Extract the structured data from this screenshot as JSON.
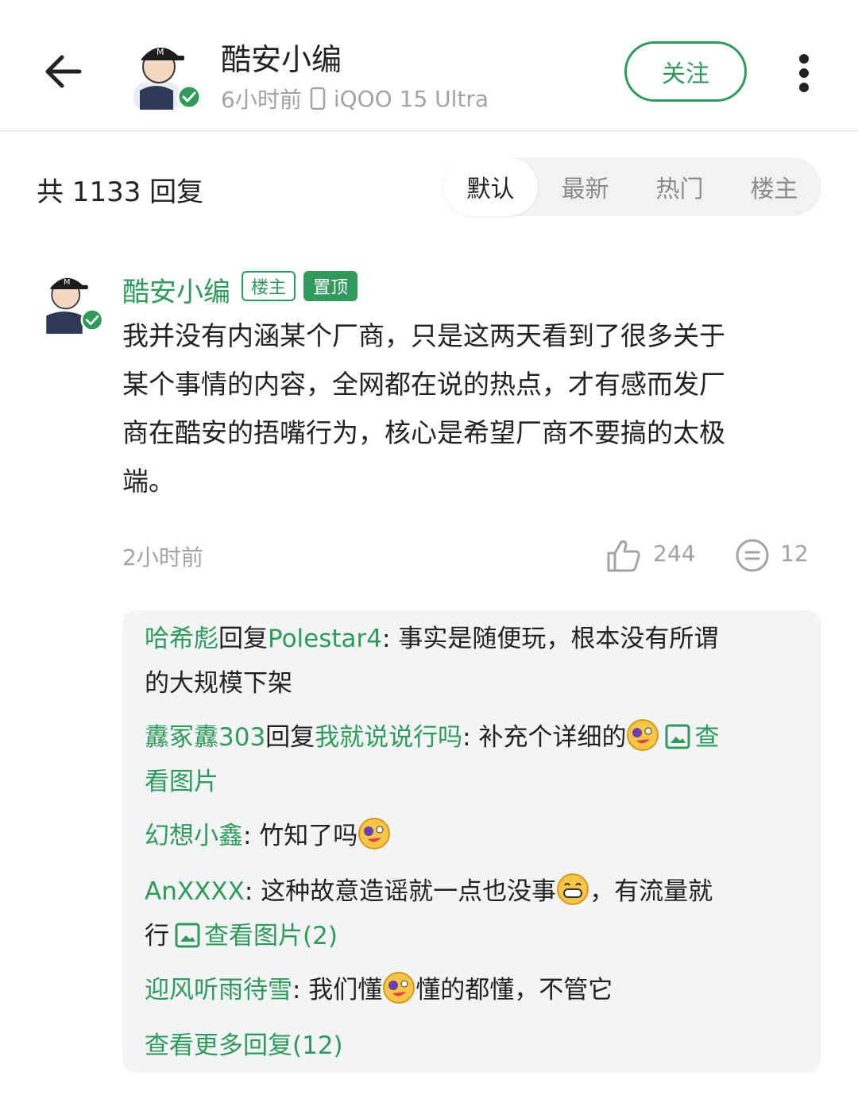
{
  "header": {
    "title": "酷安小编",
    "time": "6小时前",
    "device": "iQOO 15 Ultra",
    "follow_label": "关注"
  },
  "reply_bar": {
    "count_text": "共 1133 回复",
    "tabs": [
      "默认",
      "最新",
      "热门",
      "楼主"
    ],
    "active_tab": "默认"
  },
  "comment": {
    "author": "酷安小编",
    "badge_owner": "楼主",
    "badge_pinned": "置顶",
    "lines": [
      "我并没有内涵某个厂商，只是这两天看到了很多关于",
      "某个事情的内容，全网都在说的热点，才有感而发厂",
      "商在酷安的捂嘴行为，核心是希望厂商不要搞的太极",
      "端。"
    ],
    "time": "2小时前",
    "likes": "244",
    "comments": "12"
  },
  "replies": [
    {
      "user": "哈希彪",
      "reply_word": "回复",
      "target": "Polestar4",
      "text1": ": 事实是随便玩，根本没有所谓",
      "text2": "的大规模下架"
    },
    {
      "user": "纛冢纛303",
      "reply_word": "回复",
      "target": "我就说说行吗",
      "text1": ": 补充个详细的",
      "link1": "查",
      "link2": "看图片"
    },
    {
      "user": "幻想小鑫",
      "text1": ": 竹知了吗"
    },
    {
      "user": "AnXXXX",
      "text1": ": 这种故意造谣就一点也没事",
      "text1b": "，有流量就",
      "text2": "行",
      "link": "查看图片(2)"
    },
    {
      "user": "迎风听雨待雪",
      "text1": ": 我们懂",
      "text1b": "懂的都懂，不管它"
    }
  ],
  "more_replies": "查看更多回复(12)",
  "colors": {
    "accent": "#2f9a5a",
    "muted": "#a3a3a3",
    "panel": "#f3f4f6"
  },
  "icons": [
    "back-arrow-icon",
    "verified-icon",
    "phone-icon",
    "more-vertical-icon",
    "thumb-up-icon",
    "comment-icon",
    "image-icon",
    "emoji-icon"
  ]
}
